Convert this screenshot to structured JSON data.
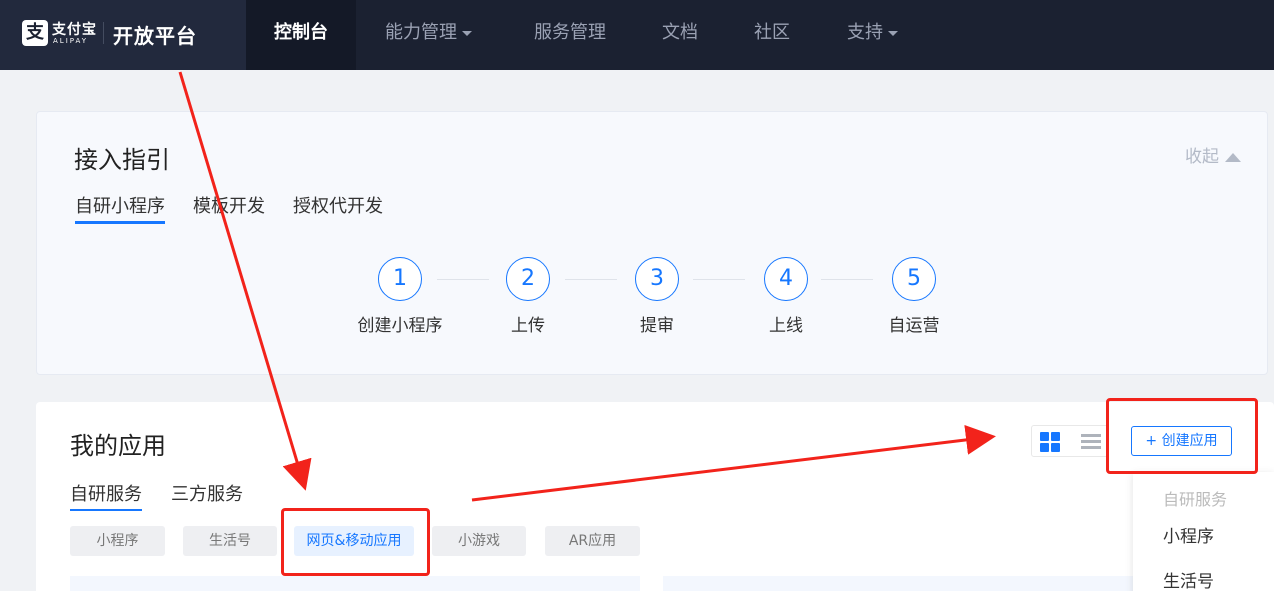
{
  "header": {
    "logo_text": "支付宝",
    "logo_sub": "ALIPAY",
    "logo_glyph": "支",
    "brand_title": "开放平台",
    "nav": [
      {
        "label": "控制台",
        "active": true
      },
      {
        "label": "能力管理",
        "dropdown": true
      },
      {
        "label": "服务管理"
      },
      {
        "label": "文档"
      },
      {
        "label": "社区"
      },
      {
        "label": "支持",
        "dropdown": true
      }
    ]
  },
  "guide": {
    "title": "接入指引",
    "collapse_label": "收起",
    "tabs": [
      "自研小程序",
      "模板开发",
      "授权代开发"
    ],
    "steps": [
      {
        "num": "1",
        "label": "创建小程序"
      },
      {
        "num": "2",
        "label": "上传"
      },
      {
        "num": "3",
        "label": "提审"
      },
      {
        "num": "4",
        "label": "上线"
      },
      {
        "num": "5",
        "label": "自运营"
      }
    ]
  },
  "apps": {
    "title": "我的应用",
    "tabs": [
      "自研服务",
      "三方服务"
    ],
    "filters": [
      "小程序",
      "生活号",
      "网页&移动应用",
      "小游戏",
      "AR应用"
    ],
    "active_filter": "网页&移动应用",
    "create_label": "+ 创建应用",
    "view_icons": [
      "grid-view-icon",
      "list-view-icon"
    ]
  },
  "create_menu": {
    "group_label": "自研服务",
    "items": [
      "小程序",
      "生活号"
    ]
  },
  "colors": {
    "nav_bg": "#1b2131",
    "accent": "#1677ff",
    "annotation_red": "#f2231b"
  }
}
